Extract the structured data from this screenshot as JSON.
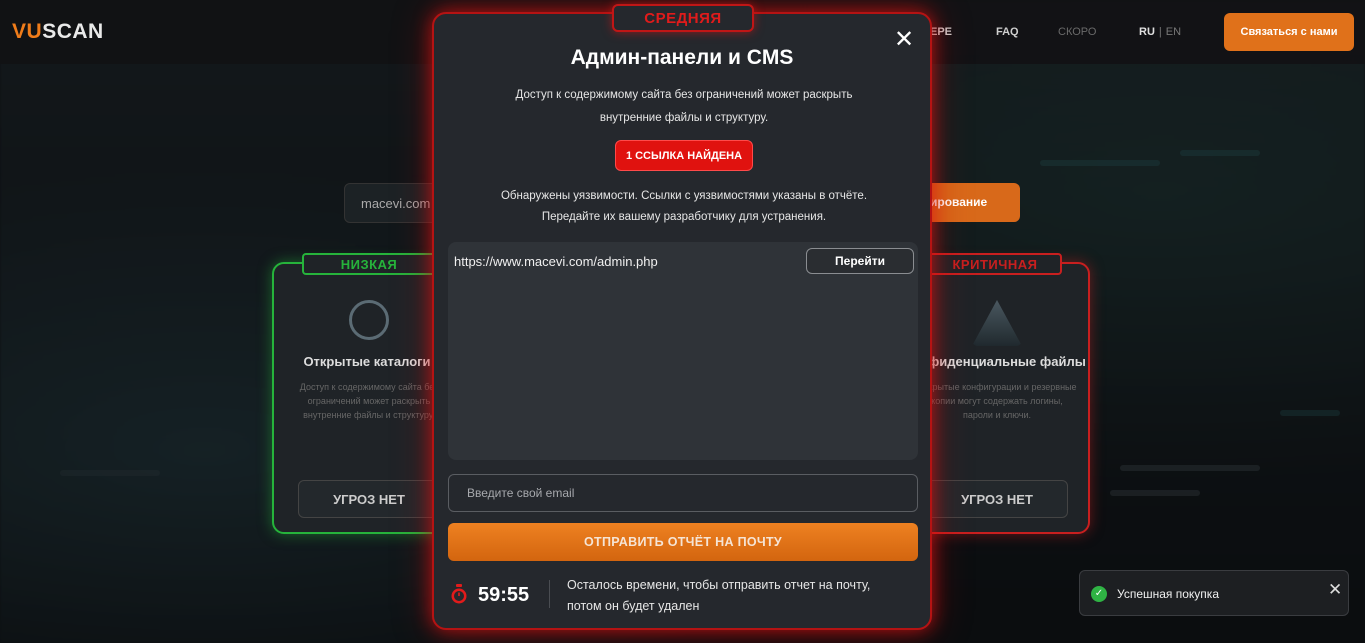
{
  "header": {
    "logo_prefix": "VU",
    "logo_suffix": "SCAN",
    "nav": [
      "ЕРЕ",
      "FAQ",
      "СКОРО"
    ],
    "lang_ru": "RU",
    "lang_sep": "|",
    "lang_en": "EN",
    "contact_label": "Связаться с нами"
  },
  "background": {
    "search_value": "macevi.com",
    "scan_button_label": "ирование",
    "cards": [
      {
        "severity": "НИЗКАЯ",
        "title": "Открытые каталоги",
        "text": "Доступ к содержимому сайта без ограничений может раскрыть внутренние файлы и структуру.",
        "button": "УГРОЗ НЕТ"
      },
      {
        "severity": "КРИТИЧНАЯ",
        "title": "Конфиденциальные файлы",
        "text": "Открытые конфигурации и резервные копии могут содержать логины, пароли и ключи.",
        "button": "УГРОЗ НЕТ"
      }
    ]
  },
  "modal": {
    "severity": "СРЕДНЯЯ",
    "title": "Админ-панели и CMS",
    "description_line1": "Доступ к содержимому сайта без ограничений может раскрыть",
    "description_line2": "внутренние файлы и структуру.",
    "found_badge": "1 ССЫЛКА НАЙДЕНА",
    "note_line1": "Обнаружены уязвимости. Ссылки с уязвимостями указаны в отчёте.",
    "note_line2": "Передайте их вашему разработчику для устранения.",
    "links": [
      {
        "url": "https://www.macevi.com/admin.php",
        "action": "Перейти"
      }
    ],
    "email_placeholder": "Введите свой email",
    "send_label": "ОТПРАВИТЬ ОТЧЁТ НА ПОЧТУ",
    "timer_value": "59:55",
    "timer_text_line1": "Осталось времени, чтобы отправить отчет на почту,",
    "timer_text_line2": "потом он будет удален"
  },
  "toast": {
    "message": "Успешная покупка",
    "status_color": "#2fb344"
  },
  "colors": {
    "accent": "#e0711a",
    "danger": "#e0120f",
    "success": "#26b33b"
  }
}
